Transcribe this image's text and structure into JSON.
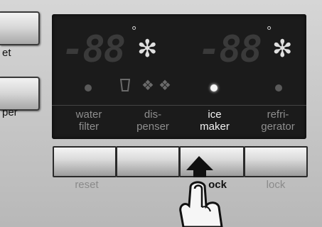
{
  "side_buttons": [
    {
      "label": "et"
    },
    {
      "label": "per"
    }
  ],
  "display": {
    "left_temp": "-88",
    "right_temp": "-88",
    "degree_symbol": "°",
    "functions": [
      {
        "label": "water filter",
        "line1": "water",
        "line2": "filter",
        "active": false
      },
      {
        "label": "dis-penser",
        "line1": "dis-",
        "line2": "penser",
        "active": false
      },
      {
        "label": "ice maker",
        "line1": "ice",
        "line2": "maker",
        "active": true
      },
      {
        "label": "refri-gerator",
        "line1": "refri-",
        "line2": "gerator",
        "active": false
      }
    ]
  },
  "buttons": [
    {
      "label": "reset"
    },
    {
      "label": ""
    },
    {
      "label": "ock"
    },
    {
      "label": "lock"
    }
  ],
  "icons": [
    "snowflake-icon",
    "water-glass-icon",
    "ice-cubes-icon",
    "crushed-ice-icon",
    "pointing-hand-icon"
  ],
  "colors": {
    "display_bg": "#1b1b1b",
    "active_text": "#f2f2f2",
    "inactive_text": "#8e8e8e"
  }
}
